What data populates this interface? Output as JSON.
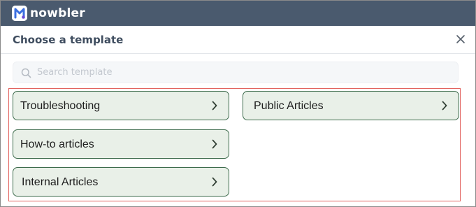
{
  "app": {
    "logo_text": "nowbler"
  },
  "dialog": {
    "title": "Choose a template",
    "search": {
      "placeholder": "Search template",
      "value": ""
    },
    "templates": [
      {
        "label": "Troubleshooting"
      },
      {
        "label": "Public Articles"
      },
      {
        "label": "How-to articles"
      },
      {
        "label": "Internal Articles"
      }
    ]
  },
  "icons": {
    "logo": "nowbler-logo-icon",
    "close": "close-icon",
    "search": "search-icon",
    "chevron": "chevron-right-icon"
  },
  "colors": {
    "topbar": "#4a5a6e",
    "card_background": "#e9f0e8",
    "card_border": "#3d6b4c",
    "highlight_outline": "#e2625e"
  }
}
